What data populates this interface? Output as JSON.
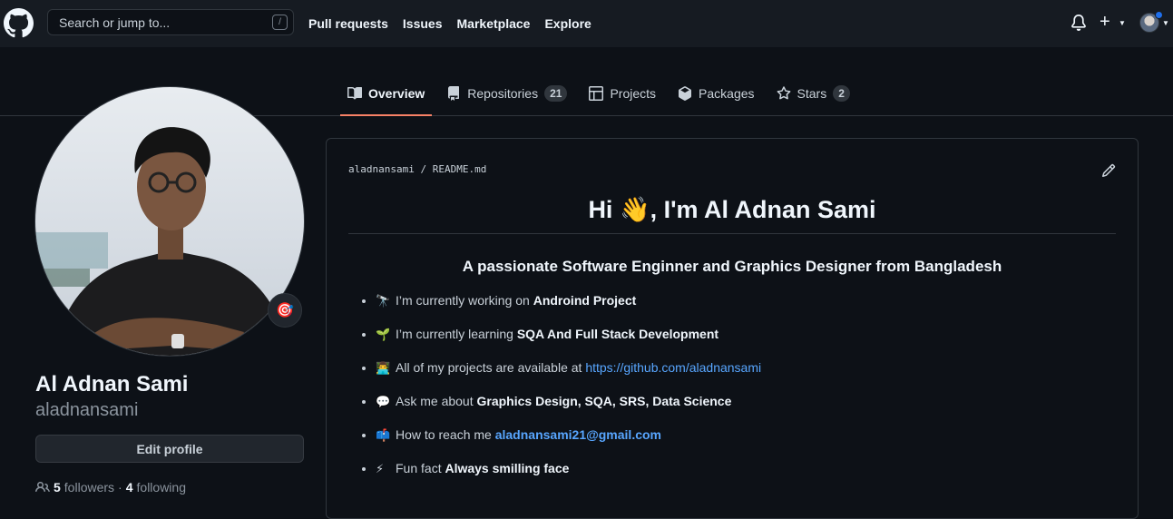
{
  "header": {
    "search_placeholder": "Search or jump to...",
    "search_shortcut": "/",
    "nav": [
      "Pull requests",
      "Issues",
      "Marketplace",
      "Explore"
    ],
    "plus_label": "+"
  },
  "tabs": [
    {
      "label": "Overview",
      "icon": "book-icon",
      "active": true
    },
    {
      "label": "Repositories",
      "icon": "repo-icon",
      "count": "21"
    },
    {
      "label": "Projects",
      "icon": "table-icon"
    },
    {
      "label": "Packages",
      "icon": "package-icon"
    },
    {
      "label": "Stars",
      "icon": "star-icon",
      "count": "2"
    }
  ],
  "profile": {
    "name": "Al Adnan Sami",
    "username": "aladnansami",
    "status_emoji": "🎯",
    "edit_label": "Edit profile",
    "followers_count": "5",
    "followers_label": "followers",
    "separator": "·",
    "following_count": "4",
    "following_label": "following"
  },
  "readme": {
    "owner": "aladnansami",
    "slash": "/",
    "file": "README.md",
    "heading_pre": "Hi ",
    "heading_emoji": "👋",
    "heading_post": ", I'm Al Adnan Sami",
    "subheading": "A passionate Software Enginner and Graphics Designer from Bangladesh",
    "items": [
      {
        "emoji": "🔭",
        "text": "I’m currently working on ",
        "bold": "Androind Project",
        "link": ""
      },
      {
        "emoji": "🌱",
        "text": "I’m currently learning ",
        "bold": "SQA And Full Stack Development",
        "link": ""
      },
      {
        "emoji": "👨‍💻",
        "text": "All of my projects are available at ",
        "bold": "",
        "link": "https://github.com/aladnansami"
      },
      {
        "emoji": "💬",
        "text": "Ask me about ",
        "bold": "Graphics Design, SQA, SRS, Data Science",
        "link": ""
      },
      {
        "emoji": "📫",
        "text": "How to reach me ",
        "bold": "",
        "link": "aladnansami21@gmail.com"
      },
      {
        "emoji": "⚡",
        "text": "Fun fact ",
        "bold": "Always smilling face",
        "link": ""
      }
    ]
  },
  "colors": {
    "accent_underline": "#f78166",
    "link": "#58a6ff",
    "notification_dot": "#1f6feb"
  }
}
